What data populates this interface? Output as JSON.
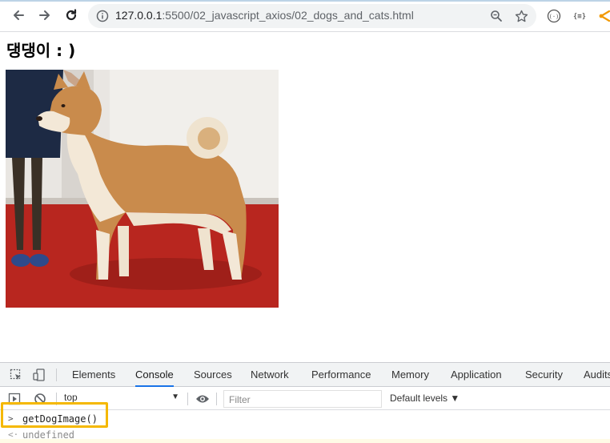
{
  "browser": {
    "url_host": "127.0.0.1",
    "url_rest": ":5500/02_javascript_axios/02_dogs_and_cats.html"
  },
  "page": {
    "heading": "댕댕이 : )"
  },
  "devtools": {
    "tabs": [
      "Elements",
      "Console",
      "Sources",
      "Network",
      "Performance",
      "Memory",
      "Application",
      "Security",
      "Audits"
    ],
    "active_tab": "Console",
    "context": "top",
    "filter_placeholder": "Filter",
    "levels_label": "Default levels ▼",
    "console": {
      "input": "getDogImage()",
      "result": "undefined"
    }
  },
  "colors": {
    "accent": "#1a73e8",
    "highlight": "#f5b800",
    "floor": "#b8261f"
  }
}
